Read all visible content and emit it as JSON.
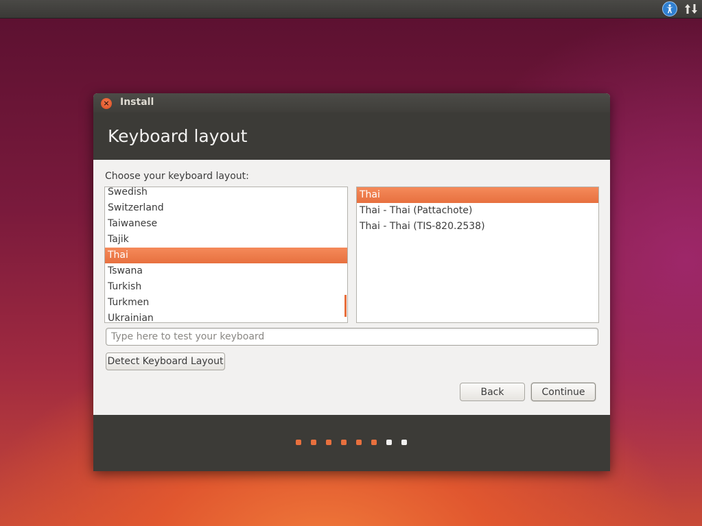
{
  "window": {
    "title": "Install",
    "page_title": "Keyboard layout"
  },
  "layout": {
    "label": "Choose your keyboard layout:",
    "languages": [
      {
        "label": "Swedish",
        "selected": false
      },
      {
        "label": "Switzerland",
        "selected": false
      },
      {
        "label": "Taiwanese",
        "selected": false
      },
      {
        "label": "Tajik",
        "selected": false
      },
      {
        "label": "Thai",
        "selected": true
      },
      {
        "label": "Tswana",
        "selected": false
      },
      {
        "label": "Turkish",
        "selected": false
      },
      {
        "label": "Turkmen",
        "selected": false
      },
      {
        "label": "Ukrainian",
        "selected": false
      }
    ],
    "variants": [
      {
        "label": "Thai",
        "selected": true
      },
      {
        "label": "Thai - Thai (Pattachote)",
        "selected": false
      },
      {
        "label": "Thai - Thai (TIS-820.2538)",
        "selected": false
      }
    ],
    "test_input": {
      "value": "",
      "placeholder": "Type here to test your keyboard"
    },
    "detect_button": "Detect Keyboard Layout"
  },
  "navigation": {
    "back_label": "Back",
    "continue_label": "Continue"
  },
  "progress": {
    "total_steps": 8,
    "completed_steps": 6,
    "done_color": "#e8703e",
    "todo_color": "#f2f1f0"
  },
  "topbar": {
    "icons": [
      "accessibility-icon",
      "network-icon"
    ]
  },
  "colors": {
    "accent": "#e7703f",
    "header_bg": "#3c3b37"
  }
}
